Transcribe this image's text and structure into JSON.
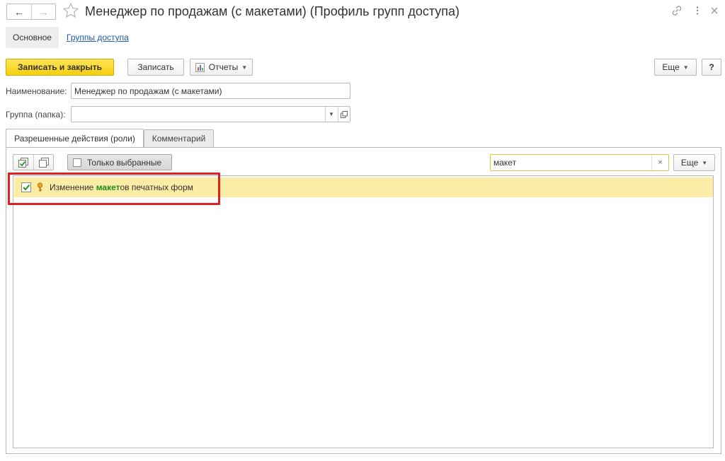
{
  "window": {
    "title": "Менеджер по продажам (с макетами) (Профиль групп доступа)",
    "back_icon": "arrow-left-icon",
    "forward_icon": "arrow-right-icon",
    "favorite_icon": "star-icon",
    "link_icon": "link-icon",
    "menu_icon": "more-vertical-icon",
    "close_icon": "close-icon"
  },
  "sections": {
    "main": "Основное",
    "access_groups": "Группы доступа"
  },
  "commands": {
    "save_and_close": "Записать и закрыть",
    "save": "Записать",
    "reports": "Отчеты",
    "more": "Еще",
    "help": "?"
  },
  "form": {
    "name_label": "Наименование:",
    "name_value": "Менеджер по продажам (с макетами)",
    "group_label": "Группа (папка):",
    "group_value": ""
  },
  "tabs": {
    "roles": "Разрешенные действия (роли)",
    "comment": "Комментарий"
  },
  "toolbar": {
    "only_selected": "Только выбранные",
    "search_value": "макет",
    "clear": "×",
    "more": "Еще"
  },
  "list": {
    "rows": [
      {
        "checked": true,
        "text_prefix": "Изменение ",
        "text_match": "макет",
        "text_suffix": "ов печатных форм"
      }
    ]
  },
  "colors": {
    "primary_button": "#f6cf0c",
    "selected_row": "#fbeda6",
    "search_match": "#1f8b1f",
    "highlight_frame": "#e02020",
    "link": "#1a5aa8"
  }
}
